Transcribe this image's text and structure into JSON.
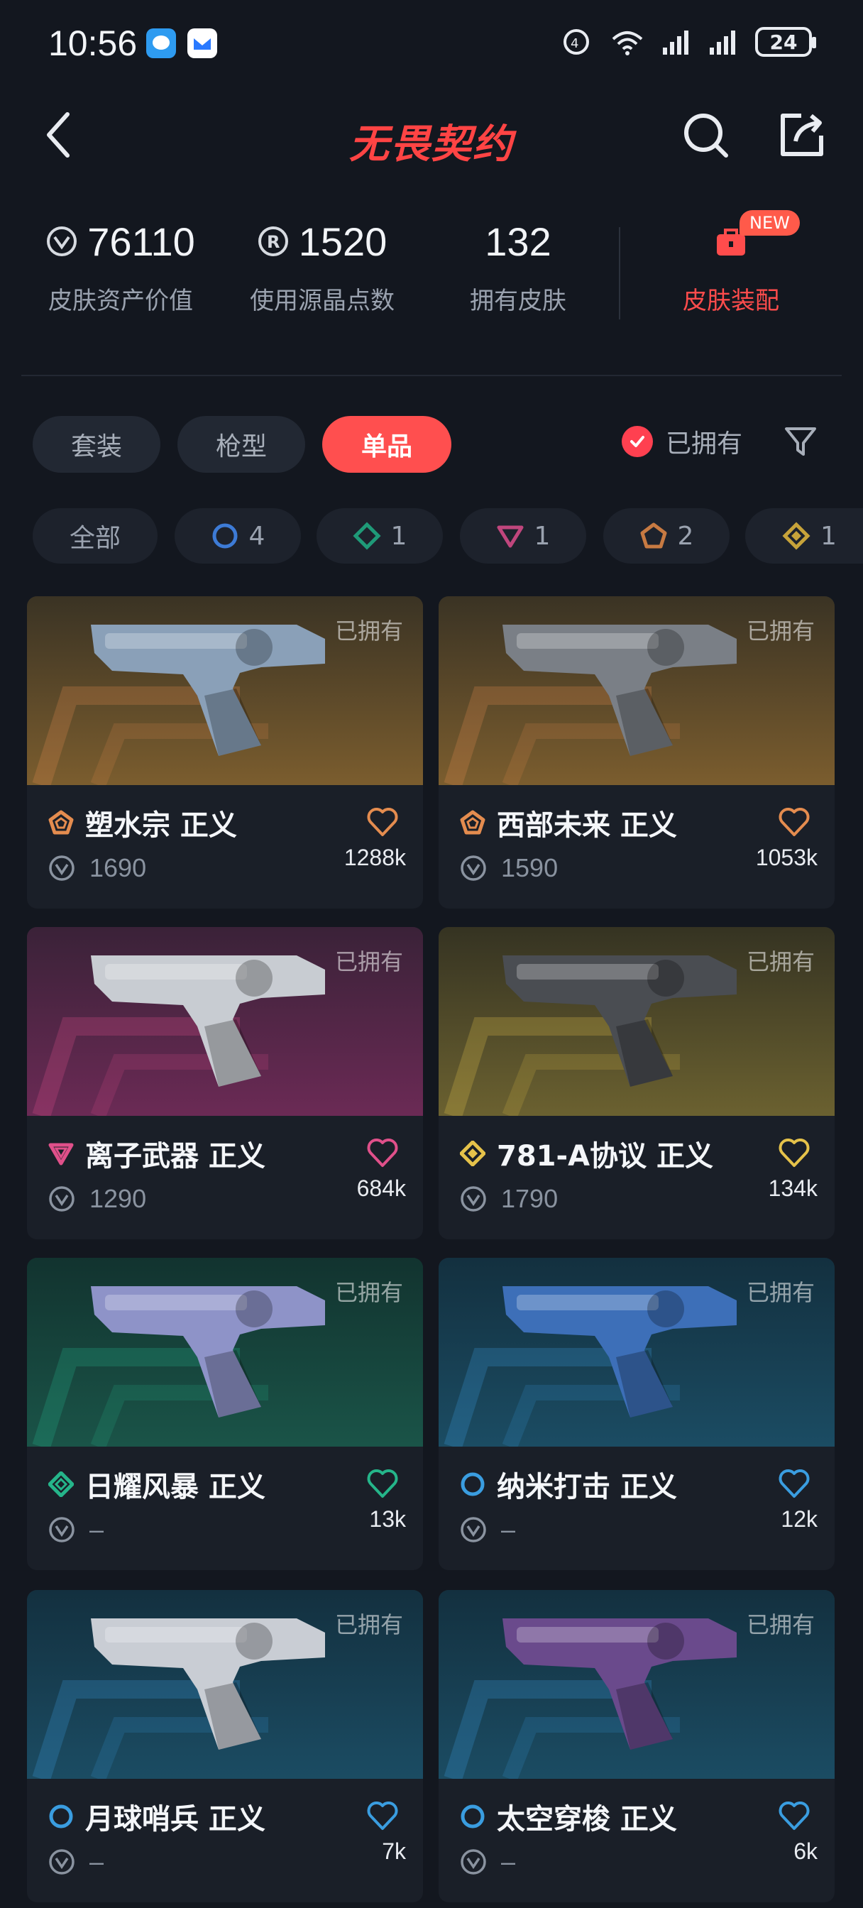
{
  "status_bar": {
    "time": "10:56",
    "battery": "24"
  },
  "header": {
    "title": "无畏契约"
  },
  "stats": [
    {
      "value": "76110",
      "label": "皮肤资产价值",
      "icon": "vp-icon"
    },
    {
      "value": "1520",
      "label": "使用源晶点数",
      "icon": "radianite-icon"
    },
    {
      "value": "132",
      "label": "拥有皮肤"
    },
    {
      "label": "皮肤装配",
      "badge": "NEW",
      "icon": "bag-icon"
    }
  ],
  "tabs": [
    {
      "label": "套装"
    },
    {
      "label": "枪型"
    },
    {
      "label": "单品",
      "active": true
    }
  ],
  "owned_filter": {
    "label": "已拥有",
    "checked": true
  },
  "chips": [
    {
      "label": "全部"
    },
    {
      "count": "4",
      "tier": "select",
      "color": "#3d7bd6"
    },
    {
      "count": "1",
      "tier": "deluxe",
      "color": "#1f9a78"
    },
    {
      "count": "1",
      "tier": "premium",
      "color": "#c0467d"
    },
    {
      "count": "2",
      "tier": "ultra",
      "color": "#c77a42"
    },
    {
      "count": "1",
      "tier": "exclusive",
      "color": "#c7a33a"
    }
  ],
  "cards": [
    {
      "name": "塑水宗 正义",
      "price": "1690",
      "likes": "1288k",
      "owned": "已拥有",
      "tier_color": "#e48c4f",
      "bg": "#3a3324",
      "bg2": "#7b5d2e"
    },
    {
      "name": "西部未来 正义",
      "price": "1590",
      "likes": "1053k",
      "owned": "已拥有",
      "tier_color": "#e48c4f",
      "bg": "#3a3324",
      "bg2": "#7b5d2e"
    },
    {
      "name": "离子武器 正义",
      "price": "1290",
      "likes": "684k",
      "owned": "已拥有",
      "tier_color": "#e0508a",
      "bg": "#3a2238",
      "bg2": "#6b2a55"
    },
    {
      "name": "781-A协议 正义",
      "price": "1790",
      "likes": "134k",
      "owned": "已拥有",
      "tier_color": "#e5c24a",
      "bg": "#353322",
      "bg2": "#6b6130"
    },
    {
      "name": "日耀风暴 正义",
      "price": "–",
      "likes": "13k",
      "owned": "已拥有",
      "tier_color": "#25b58a",
      "bg": "#12332f",
      "bg2": "#1a5448"
    },
    {
      "name": "纳米打击 正义",
      "price": "–",
      "likes": "12k",
      "owned": "已拥有",
      "tier_color": "#3a9de0",
      "bg": "#13303f",
      "bg2": "#1b4c63"
    },
    {
      "name": "月球哨兵 正义",
      "price": "–",
      "likes": "7k",
      "owned": "已拥有",
      "tier_color": "#3a9de0",
      "bg": "#13303f",
      "bg2": "#1b4c63"
    },
    {
      "name": "太空穿梭 正义",
      "price": "–",
      "likes": "6k",
      "owned": "已拥有",
      "tier_color": "#3a9de0",
      "bg": "#13303f",
      "bg2": "#1b4c63"
    }
  ]
}
